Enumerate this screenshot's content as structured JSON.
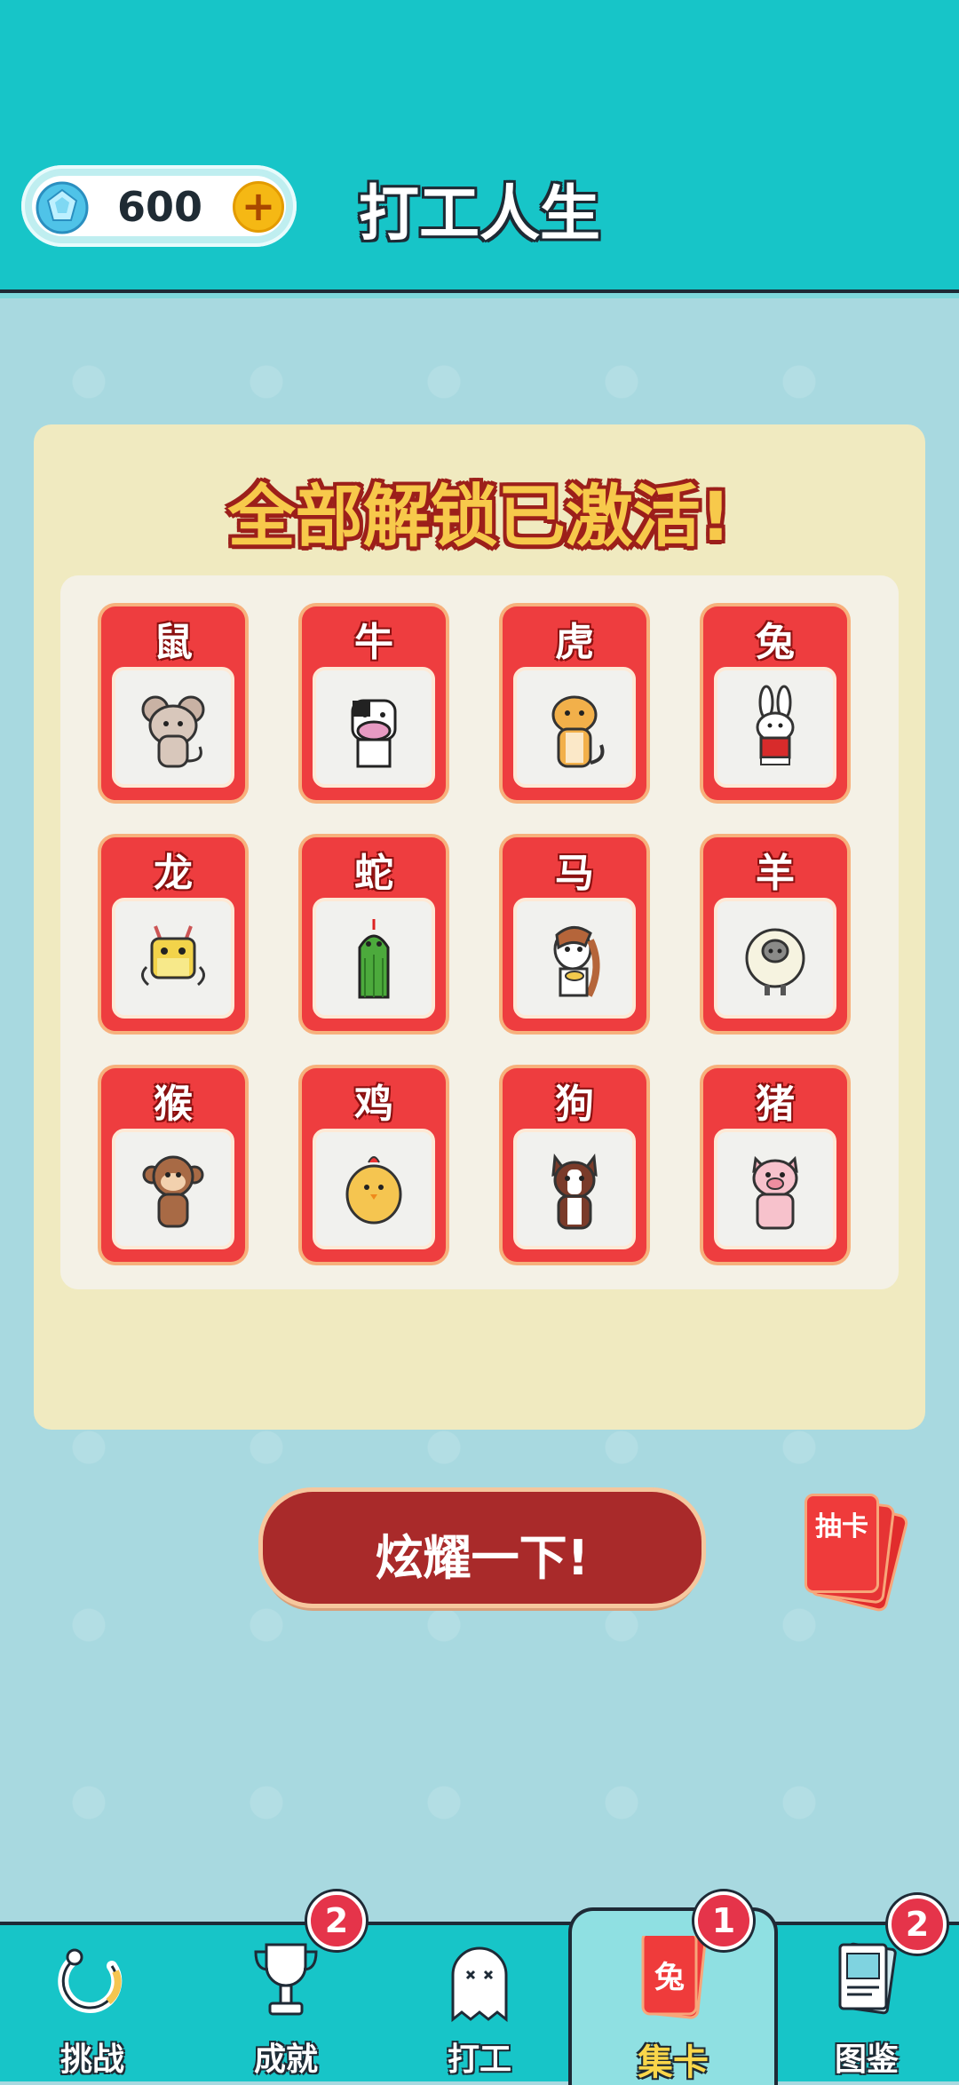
{
  "header": {
    "title": "打工人生",
    "gem_count": "600",
    "colors": {
      "bar": "#17c5c8",
      "gem": "#4fc3e8",
      "plus": "#f5b814"
    }
  },
  "panel": {
    "title": "全部解锁已激活!",
    "cards": [
      {
        "name": "鼠",
        "icon": "rat-icon"
      },
      {
        "name": "牛",
        "icon": "cow-icon"
      },
      {
        "name": "虎",
        "icon": "tiger-icon"
      },
      {
        "name": "兔",
        "icon": "rabbit-icon"
      },
      {
        "name": "龙",
        "icon": "dragon-icon"
      },
      {
        "name": "蛇",
        "icon": "snake-icon"
      },
      {
        "name": "马",
        "icon": "horse-icon"
      },
      {
        "name": "羊",
        "icon": "sheep-icon"
      },
      {
        "name": "猴",
        "icon": "monkey-icon"
      },
      {
        "name": "鸡",
        "icon": "chicken-icon"
      },
      {
        "name": "狗",
        "icon": "dog-icon"
      },
      {
        "name": "猪",
        "icon": "pig-icon"
      }
    ]
  },
  "actions": {
    "show_off_label": "炫耀一下!",
    "draw_card_label": "抽卡"
  },
  "nav": {
    "items": [
      {
        "label": "挑战",
        "icon": "challenge-icon"
      },
      {
        "label": "成就",
        "icon": "trophy-icon",
        "badge": "2"
      },
      {
        "label": "打工",
        "icon": "ghost-icon"
      },
      {
        "label": "集卡",
        "icon": "card-collect-icon",
        "badge": "1",
        "active": true,
        "icon_text": "兔"
      },
      {
        "label": "图鉴",
        "icon": "book-icon",
        "badge": "2"
      }
    ]
  }
}
